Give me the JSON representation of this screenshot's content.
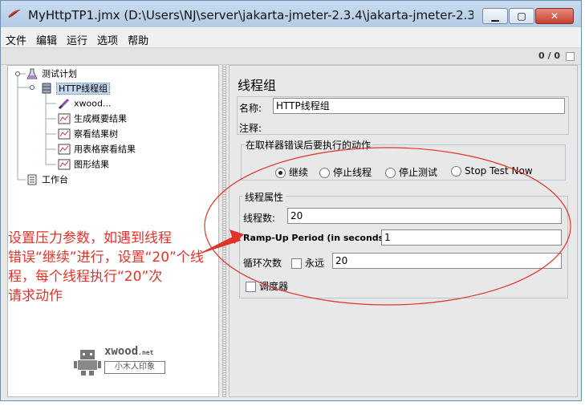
{
  "window": {
    "title": "MyHttpTP1.jmx (D:\\Users\\NJ\\server\\jakarta-jmeter-2.3.4\\jakarta-jmeter-2.3..."
  },
  "menu": [
    "文件",
    "编辑",
    "运行",
    "选项",
    "帮助"
  ],
  "toolbar": {
    "counter": "0 / 0"
  },
  "tree": {
    "test_plan": "测试计划",
    "thread_group": "HTTP线程组",
    "children": [
      "xwood...",
      "生成概要结果",
      "察看结果树",
      "用表格察看结果",
      "图形结果"
    ],
    "workbench": "工作台"
  },
  "panel": {
    "heading": "线程组",
    "name_label": "名称:",
    "name_value": "HTTP线程组",
    "comment_label": "注释:",
    "error_group_title": "在取样器错误后要执行的动作",
    "error_options": [
      "继续",
      "停止线程",
      "停止测试",
      "Stop Test Now"
    ],
    "error_selected": "继续",
    "props_title": "线程属性",
    "threads_label": "线程数:",
    "threads_value": "20",
    "rampup_label": "Ramp-Up Period (in seconds):",
    "rampup_value": "1",
    "loop_label": "循环次数",
    "forever_label": "永远",
    "loop_value": "20",
    "scheduler_label": "调度器"
  },
  "annotation": {
    "lines": [
      "设置压力参数，如遇到线程",
      "错误“继续”进行，设置“20”个线",
      "程，每个线程执行“20”次",
      "请求动作"
    ]
  },
  "logo": {
    "brand": "xwood",
    "suffix": ".net",
    "tagline": "小木人印象"
  },
  "colors": {
    "annotation": "#e0332a",
    "selection": "#c3d6ee"
  }
}
